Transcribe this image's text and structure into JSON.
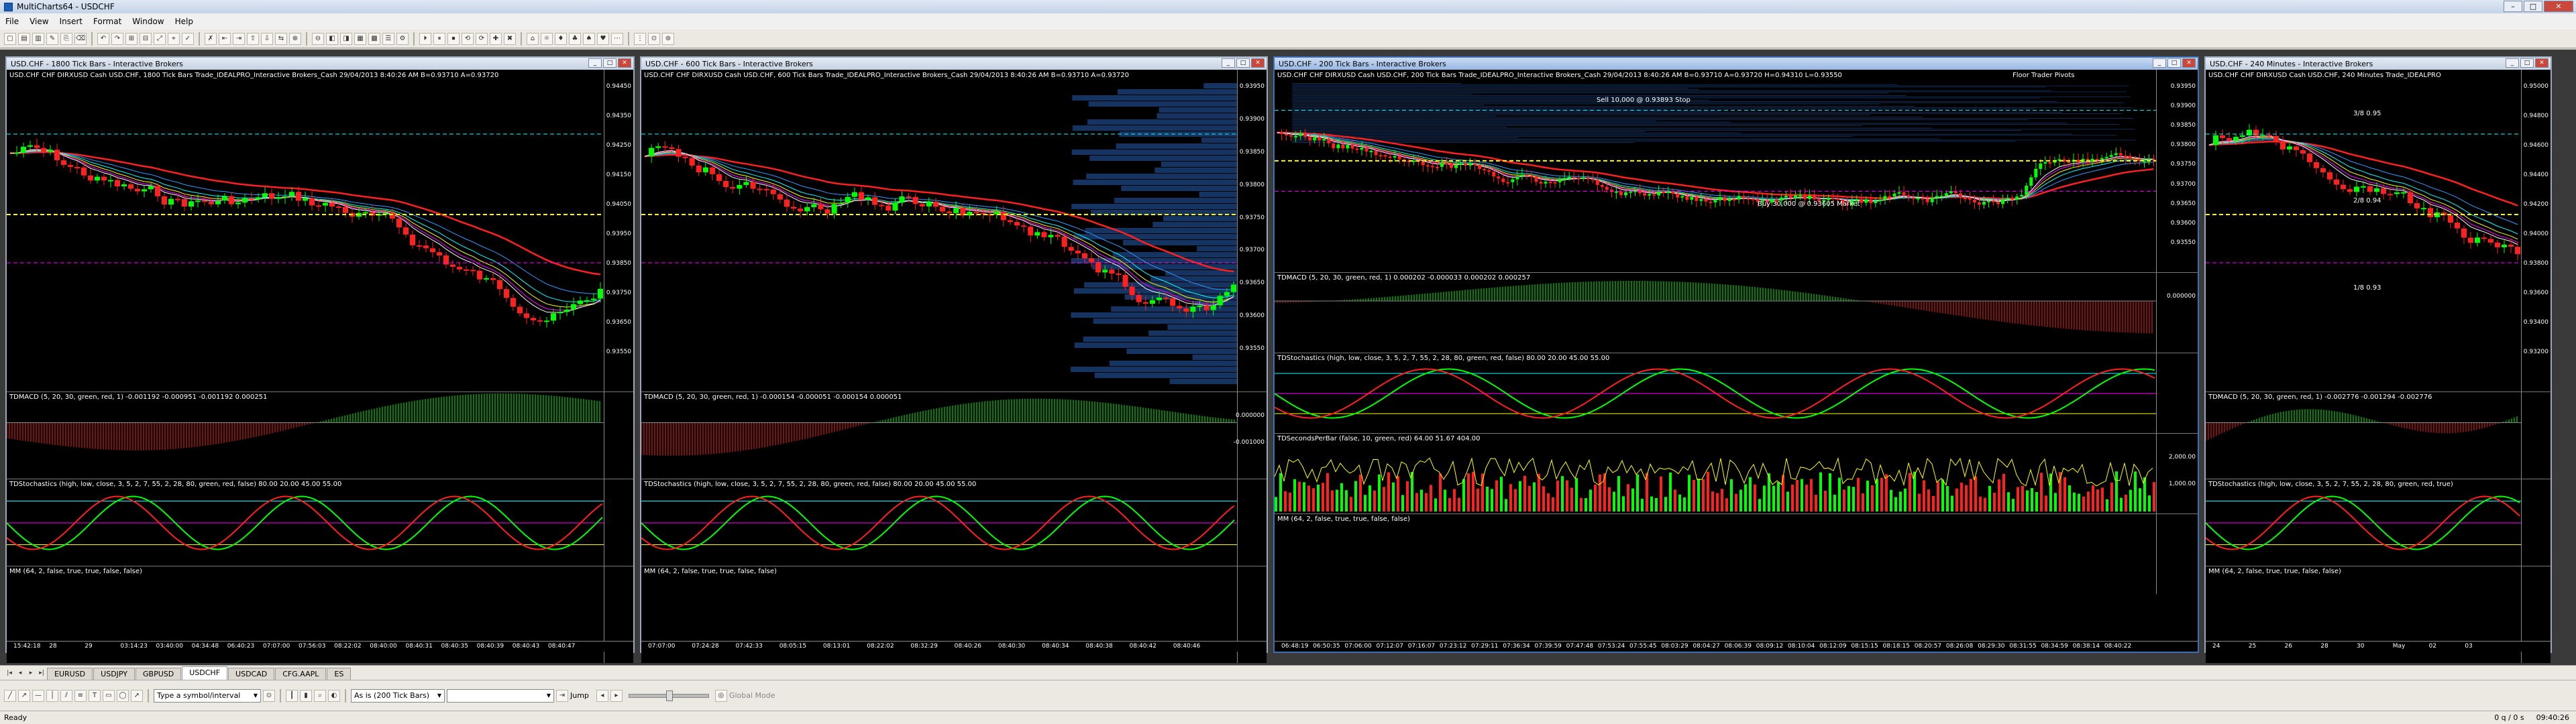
{
  "app": {
    "title": "MultiCharts64 - USDCHF"
  },
  "menu": [
    "File",
    "View",
    "Insert",
    "Format",
    "Window",
    "Help"
  ],
  "windows": [
    {
      "title": "USD.CHF - 1800 Tick Bars - Interactive Brokers",
      "header": "USD.CHF  CHF DIRXUSD Cash USD.CHF, 1800 Tick Bars  Trade_IDEALPRO_Interactive Brokers_Cash  29/04/2013  8:40:26 AM  B=0.93710  A=0.93720",
      "price_ticks": [
        "0.94450",
        "0.94350",
        "0.94250",
        "0.94150",
        "0.94050",
        "0.93950",
        "0.93850",
        "0.93750",
        "0.93650",
        "0.93550"
      ],
      "panes": [
        {
          "label": "TDMACD  (5, 20, 30, green, red, 1)  -0.001192  -0.000951  -0.001192  0.000251",
          "ticks": []
        },
        {
          "label": "TDStochastics  (high, low, close, 3, 5, 2, 7, 55, 2, 28, 80, green, red, false)  80.00  20.00  45.00  55.00",
          "ticks": []
        },
        {
          "label": "MM  (64, 2, false, true, true, false, false)",
          "ticks": []
        }
      ],
      "time_labels": [
        "15:42:18",
        "28",
        "29",
        "03:14:23",
        "03:40:00",
        "04:34:48",
        "06:40:23",
        "07:07:00",
        "07:56:03",
        "08:22:02",
        "08:40:00",
        "08:40:31",
        "08:40:35",
        "08:40:39",
        "08:40:43",
        "08:40:47"
      ]
    },
    {
      "title": "USD.CHF - 600 Tick Bars - Interactive Brokers",
      "header": "USD.CHF  CHF DIRXUSD Cash USD.CHF, 600 Tick Bars  Trade_IDEALPRO_Interactive Brokers_Cash  29/04/2013  8:40:26 AM  B=0.93710  A=0.93720",
      "price_ticks": [
        "0.93950",
        "0.93900",
        "0.93850",
        "0.93800",
        "0.93750",
        "0.93700",
        "0.93650",
        "0.93600",
        "0.93550"
      ],
      "panes": [
        {
          "label": "TDMACD  (5, 20, 30, green, red, 1)  -0.000154  -0.000051  -0.000154  0.000051",
          "ticks": [
            "0.000000",
            "-0.001000"
          ]
        },
        {
          "label": "TDStochastics  (high, low, close, 3, 5, 2, 7, 55, 2, 28, 80, green, red, false)  80.00  20.00  45.00  55.00",
          "ticks": []
        },
        {
          "label": "MM  (64, 2, false, true, true, false, false)",
          "ticks": []
        }
      ],
      "time_labels": [
        "07:07:00",
        "07:24:28",
        "07:42:33",
        "08:05:15",
        "08:13:01",
        "08:22:02",
        "08:32:29",
        "08:40:26",
        "08:40:30",
        "08:40:34",
        "08:40:38",
        "08:40:42",
        "08:40:46"
      ]
    },
    {
      "title": "USD.CHF - 200 Tick Bars - Interactive Brokers",
      "header": "USD.CHF  CHF DIRXUSD Cash USD.CHF, 200 Tick Bars  Trade_IDEALPRO_Interactive Brokers_Cash  29/04/2013  8:40:26 AM  B=0.93710  A=0.93720  H=0.94310  L=0.93550",
      "floor_pivots": "Floor Trader Pivots",
      "price_ticks": [
        "0.93950",
        "0.93900",
        "0.93850",
        "0.93800",
        "0.93750",
        "0.93700",
        "0.93650",
        "0.93600",
        "0.93550"
      ],
      "annotations": [
        "Sell 10,000 @ 0.93893 Stop",
        "Buy 30,000 @ 0.93605 Market"
      ],
      "panes": [
        {
          "label": "TDMACD  (5, 20, 30, green, red, 1)  0.000202  -0.000033  0.000202  0.000257",
          "ticks": [
            "0.000000"
          ]
        },
        {
          "label": "TDStochastics  (high, low, close, 3, 5, 2, 7, 55, 2, 28, 80, green, red, false)  80.00  20.00  45.00  55.00",
          "ticks": []
        },
        {
          "label": "TDSecondsPerBar  (false, 10, green, red)  64.00  51.67  404.00",
          "ticks": [
            "2,000.00",
            "1,000.00"
          ]
        },
        {
          "label": "MM  (64, 2, false, true, true, false, false)",
          "ticks": []
        }
      ],
      "time_labels": [
        "06:48:19",
        "06:50:35",
        "07:06:00",
        "07:12:07",
        "07:16:07",
        "07:23:12",
        "07:29:11",
        "07:36:34",
        "07:39:59",
        "07:47:48",
        "07:53:24",
        "07:55:45",
        "08:03:29",
        "08:04:27",
        "08:06:39",
        "08:09:12",
        "08:10:04",
        "08:12:09",
        "08:15:15",
        "08:18:15",
        "08:20:57",
        "08:26:08",
        "08:29:30",
        "08:31:55",
        "08:34:59",
        "08:38:14",
        "08:40:22"
      ]
    },
    {
      "title": "USD.CHF - 240 Minutes - Interactive Brokers",
      "header": "USD.CHF  CHF DIRXUSD Cash USD.CHF, 240 Minutes  Trade_IDEALPRO",
      "price_ticks": [
        "0.95000",
        "0.94800",
        "0.94600",
        "0.94400",
        "0.94200",
        "0.94000",
        "0.93800",
        "0.93600",
        "0.93400",
        "0.93200"
      ],
      "levels": [
        "3/8  0.95",
        "2/8  0.94",
        "1/8  0.93"
      ],
      "panes": [
        {
          "label": "TDMACD  (5, 20, 30, green, red, 1)  -0.002776  -0.001294  -0.002776",
          "ticks": []
        },
        {
          "label": "TDStochastics  (high, low, close, 3, 5, 2, 7, 55, 2, 28, 80, green, red, true)",
          "ticks": []
        },
        {
          "label": "MM  (64, 2, false, true, true, false, false)",
          "ticks": []
        }
      ],
      "time_labels": [
        "24",
        "25",
        "26",
        "28",
        "30",
        "May",
        "02",
        "03"
      ]
    }
  ],
  "tabs": [
    "EURUSD",
    "USDJPY",
    "GBPUSD",
    "USDCHF",
    "USDCAD",
    "CFG.AAPL",
    "ES"
  ],
  "active_tab": "USDCHF",
  "drawbar": {
    "symbol_placeholder": "Type a symbol/interval",
    "interval_select": "As is (200 Tick Bars)",
    "jump_label": "Jump",
    "global_mode": "Global Mode"
  },
  "status": {
    "left": "Ready",
    "events": "0 q / 0 s",
    "clock": "09:40:26"
  },
  "colors": {
    "up": "#00ff00",
    "down": "#ff0000",
    "ma_red": "#ff2020",
    "ma_blue": "#3399ff"
  }
}
